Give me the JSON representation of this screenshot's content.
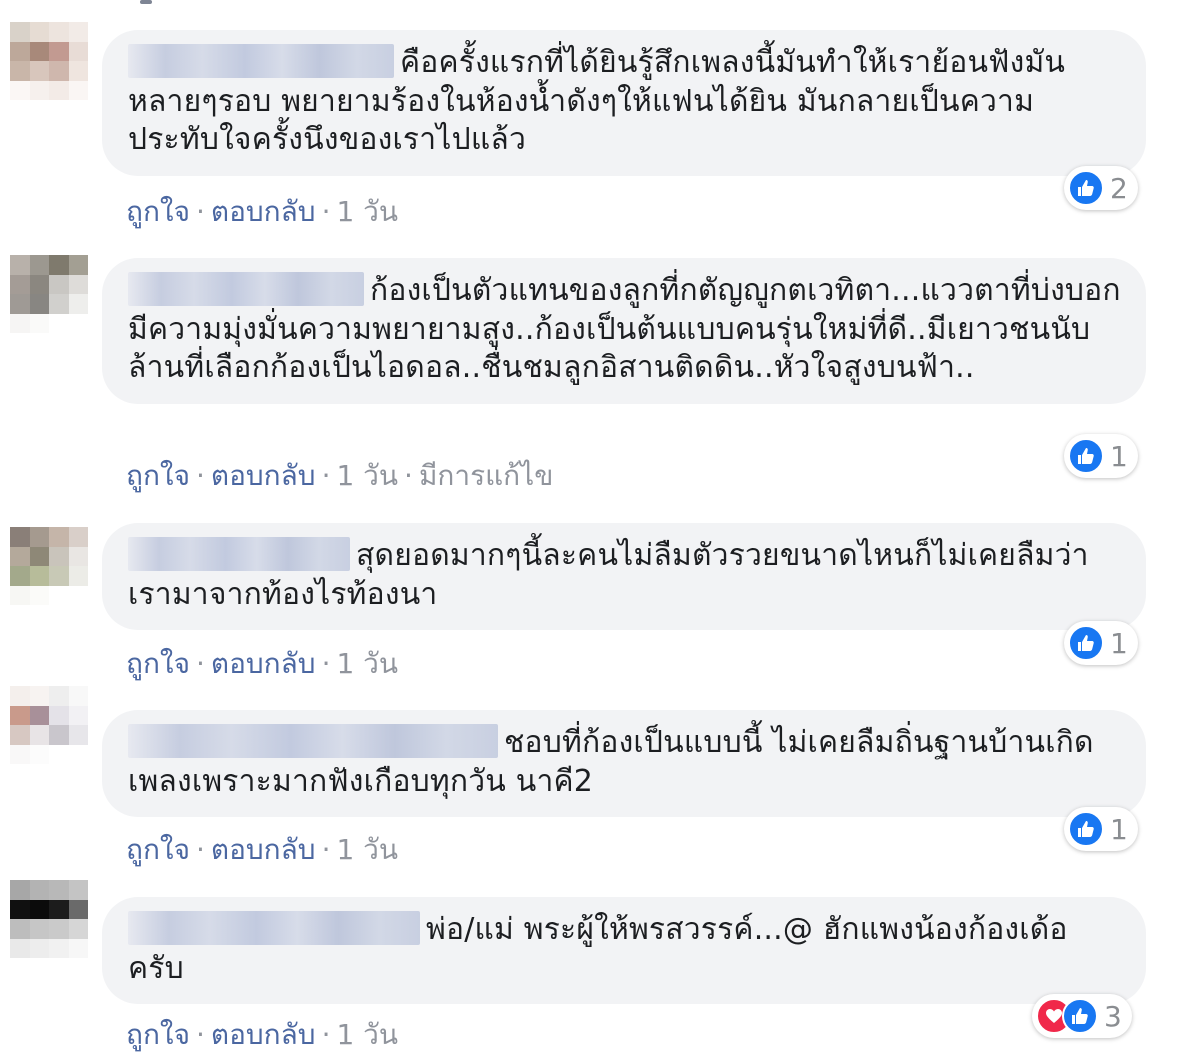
{
  "comments": [
    {
      "text": "คือครั้งแรกที่ได้ยินรู้สึกเพลงนี้มันทำให้เราย้อนฟังมันหลายๆรอบ พยายามร้องในห้องน้ำดังๆให้แฟนได้ยิน มันกลายเป็นความประทับใจครั้งนึงของเราไปแล้ว",
      "like": "ถูกใจ",
      "reply": "ตอบกลับ",
      "time": "1 วัน",
      "edited": "",
      "reactions": [
        "like"
      ],
      "count": "2"
    },
    {
      "text": "ก้องเป็นตัวแทนของลูกที่กตัญญูกตเวทิตา...แววตาที่บ่งบอกมีความมุ่งมั่นความพยายามสูง..ก้องเป็นต้นแบบคนรุ่นใหม่ที่ดี..มีเยาวชนนับล้านที่เลือกก้องเป็นไอดอล..ชื่นชมลูกอิสานติดดิน..หัวใจสูงบนฟ้า..",
      "like": "ถูกใจ",
      "reply": "ตอบกลับ",
      "time": "1 วัน",
      "edited": "มีการแก้ไข",
      "reactions": [
        "like"
      ],
      "count": "1"
    },
    {
      "text": "สุดยอดมากๆนี้ละคนไม่ลืมตัวรวยขนาดไหนก็ไม่เคยลืมว่าเรามาจากท้องไรท้องนา",
      "like": "ถูกใจ",
      "reply": "ตอบกลับ",
      "time": "1 วัน",
      "edited": "",
      "reactions": [
        "like"
      ],
      "count": "1"
    },
    {
      "text": "ชอบที่ก้องเป็นแบบนี้ ไม่เคยลืมถิ่นฐานบ้านเกิด เพลงเพราะมากฟังเกือบทุกวัน นาคี2",
      "like": "ถูกใจ",
      "reply": "ตอบกลับ",
      "time": "1 วัน",
      "edited": "",
      "reactions": [
        "like"
      ],
      "count": "1"
    },
    {
      "text": "พ่อ/แม่ พระผู้ให้พรสวรรค์...@ ฮักแพงน้องก้องเด้อครับ",
      "like": "ถูกใจ",
      "reply": "ตอบกลับ",
      "time": "1 วัน",
      "edited": "",
      "reactions": [
        "love",
        "like"
      ],
      "count": "3"
    }
  ],
  "colors": {
    "bubble": "#f2f3f5",
    "link": "#4b67a1",
    "meta": "#90949c",
    "like": "#1877f2",
    "love": "#f0284a"
  },
  "icons": {
    "like": "thumbs-up-icon",
    "love": "heart-icon"
  }
}
